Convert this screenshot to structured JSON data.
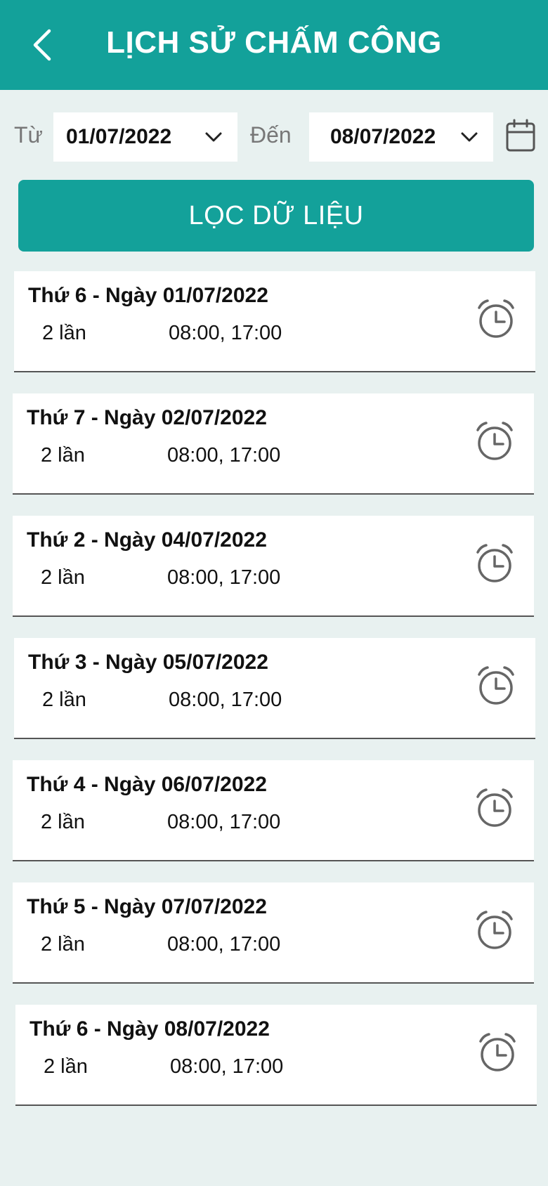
{
  "header": {
    "title": "LỊCH SỬ CHẤM CÔNG"
  },
  "filter": {
    "from_label": "Từ",
    "from_date": "01/07/2022",
    "to_label": "Đến",
    "to_date": "08/07/2022",
    "button_label": "LỌC DỮ LIỆU"
  },
  "records": [
    {
      "date": "Thứ 6 - Ngày 01/07/2022",
      "count": "2 lần",
      "times": "08:00, 17:00"
    },
    {
      "date": "Thứ 7 - Ngày 02/07/2022",
      "count": "2 lần",
      "times": "08:00, 17:00"
    },
    {
      "date": "Thứ 2 - Ngày 04/07/2022",
      "count": "2 lần",
      "times": "08:00, 17:00"
    },
    {
      "date": "Thứ 3 - Ngày 05/07/2022",
      "count": "2 lần",
      "times": "08:00, 17:00"
    },
    {
      "date": "Thứ 4 - Ngày 06/07/2022",
      "count": "2 lần",
      "times": "08:00, 17:00"
    },
    {
      "date": "Thứ 5 - Ngày 07/07/2022",
      "count": "2 lần",
      "times": "08:00, 17:00"
    },
    {
      "date": "Thứ 6 - Ngày 08/07/2022",
      "count": "2 lần",
      "times": "08:00, 17:00"
    }
  ],
  "colors": {
    "accent": "#13a19a",
    "background": "#e8f1f0"
  },
  "icons": {
    "back": "chevron-left-icon",
    "calendar": "calendar-icon",
    "record": "alarm-clock-icon"
  }
}
